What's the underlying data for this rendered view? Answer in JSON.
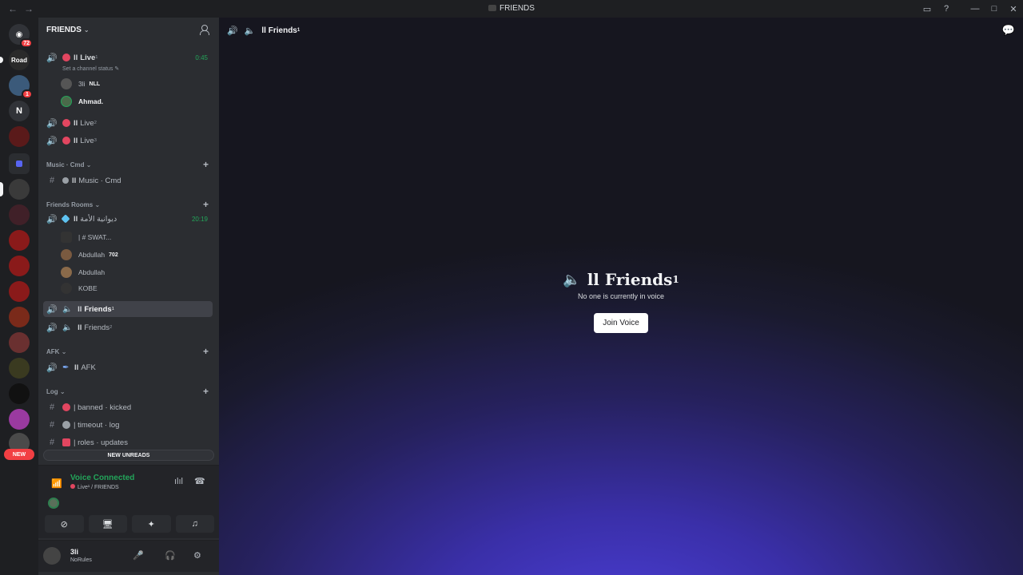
{
  "titlebar": {
    "title": "FRIENDS",
    "back_icon": "arrow-left-icon",
    "forward_icon": "arrow-right-icon"
  },
  "rail": {
    "home_badge": "72",
    "server_badge": "1",
    "n_label": "N",
    "road_label": "Road",
    "new_label": "NEW"
  },
  "guild": {
    "name": "FRIENDS"
  },
  "channels": {
    "live1": {
      "name": "Live",
      "sup": "1",
      "timer": "0:45",
      "status": "Set a channel status"
    },
    "live1_users": [
      {
        "name": "3li",
        "tag": "NLL"
      },
      {
        "name": "Ahmad.",
        "tag": ""
      }
    ],
    "live2": {
      "name": "Live",
      "sup": "2"
    },
    "live3": {
      "name": "Live",
      "sup": "3"
    },
    "cat_music": "Music · Cmd",
    "music_cmd": {
      "name": "Music · Cmd"
    },
    "cat_friends_rooms": "Friends Rooms",
    "arabic_room": {
      "name": "ديوانية الأمة",
      "timer": "20:19"
    },
    "arabic_users": [
      {
        "name": "| # SWAT...",
        "tag": ""
      },
      {
        "name": "Abdullah",
        "tag": "702"
      },
      {
        "name": "Abdullah",
        "tag": ""
      },
      {
        "name": "KOBE",
        "tag": ""
      }
    ],
    "friends1": {
      "name": "Friends",
      "sup": "1"
    },
    "friends2": {
      "name": "Friends",
      "sup": "2"
    },
    "cat_afk": "AFK",
    "afk": {
      "name": "AFK"
    },
    "cat_log": "Log",
    "banned": {
      "name": "| banned · kicked"
    },
    "timeout": {
      "name": "| timeout · log"
    },
    "roles": {
      "name": "| roles · updates"
    },
    "new_unreads": "NEW UNREADS"
  },
  "voice": {
    "title": "Voice Connected",
    "subtitle": "Live¹ / FRIENDS"
  },
  "user": {
    "name": "3li",
    "status": "NoRules"
  },
  "main": {
    "header_channel": "Friends",
    "header_sup": "1",
    "empty_title": "Friends",
    "empty_sup": "1",
    "empty_sub": "No one is currently in voice",
    "join_label": "Join Voice"
  },
  "colors": {
    "accent_green": "#23a55a",
    "danger_red": "#f23f43",
    "brand": "#5865f2"
  }
}
